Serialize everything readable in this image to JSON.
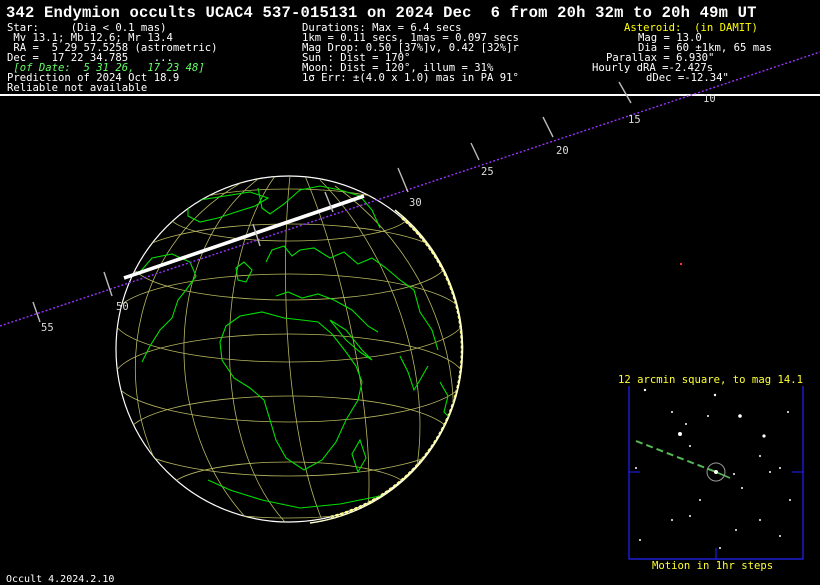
{
  "header": {
    "title": "342 Endymion occults UCAC4 537-015131 on 2024 Dec  6 from 20h 32m to 20h 49m UT",
    "star_col": [
      "Star:     (Dia < 0.1 mas)",
      " Mv 13.1; Mb 12.6; Mr 13.4",
      " RA =  5 29 57.5258 (astrometric)",
      "Dec =  17 22 34.785    ...",
      " [of Date:  5 31 26,  17 23 48]",
      "Prediction of 2024 Oct 18.9",
      "Reliable not available"
    ],
    "mid_col": [
      "Durations: Max = 6.4 secs",
      "1km = 0.11 secs, 1mas = 0.097 secs",
      "Mag Drop: 0.50 [37%]v, 0.42 [32%]r",
      "Sun : Dist = 170°",
      "Moon: Dist = 120°, illum = 31%",
      "1σ Err: ±(4.0 x 1.0) mas in PA 91°"
    ],
    "right_col": [
      "Asteroid:  (in DAMIT)",
      "Mag = 13.0",
      "Dia = 60 ±1km, 65 mas",
      "Parallax = 6.930\"",
      "Hourly dRA =-2.427s",
      "dDec =-12.34\""
    ]
  },
  "path_labels": [
    "10",
    "15",
    "20",
    "25",
    "30",
    "50",
    "55"
  ],
  "starchart": {
    "title": "12 arcmin square, to mag 14.1",
    "footer": "Motion in 1hr steps"
  },
  "footer": {
    "version": "Occult 4.2024.2.10"
  },
  "colors": {
    "background": "#000000",
    "coastline": "#00ff00",
    "graticule": "#cccc66",
    "path": "#9933ff",
    "centerline": "#ffffff",
    "highlight": "#ffff33",
    "chart_frame": "#0000ff"
  }
}
